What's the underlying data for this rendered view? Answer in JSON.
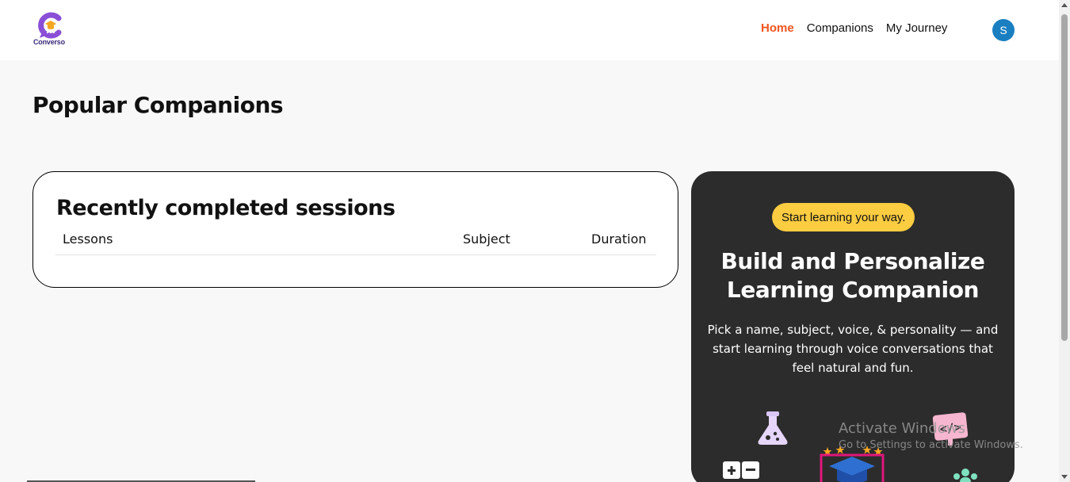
{
  "brand": {
    "name": "Converso"
  },
  "nav": {
    "links": [
      {
        "label": "Home",
        "active": true
      },
      {
        "label": "Companions",
        "active": false
      },
      {
        "label": "My Journey",
        "active": false
      }
    ],
    "avatar_initial": "S"
  },
  "colors": {
    "accent": "#f0541e",
    "avatar": "#1a7fc1",
    "badge": "#fccc41",
    "cta_bg": "#2c2c2c"
  },
  "main": {
    "title": "Popular Companions"
  },
  "sessions": {
    "title": "Recently completed sessions",
    "columns": [
      "Lessons",
      "Subject",
      "Duration"
    ],
    "rows": []
  },
  "cta": {
    "badge": "Start learning your way.",
    "title_line1": "Build and Personalize",
    "title_line2": "Learning Companion",
    "description": "Pick a name, subject, voice, & personality — and start learning through voice conversations that feel natural and fun."
  },
  "os_overlay": {
    "title": "Activate Windows",
    "subtitle": "Go to Settings to activate Windows."
  },
  "icons": [
    "converso-logo-icon",
    "flask-icon",
    "code-icon",
    "calculator-icon",
    "graduation-cap-icon",
    "people-icon",
    "star-icon"
  ]
}
